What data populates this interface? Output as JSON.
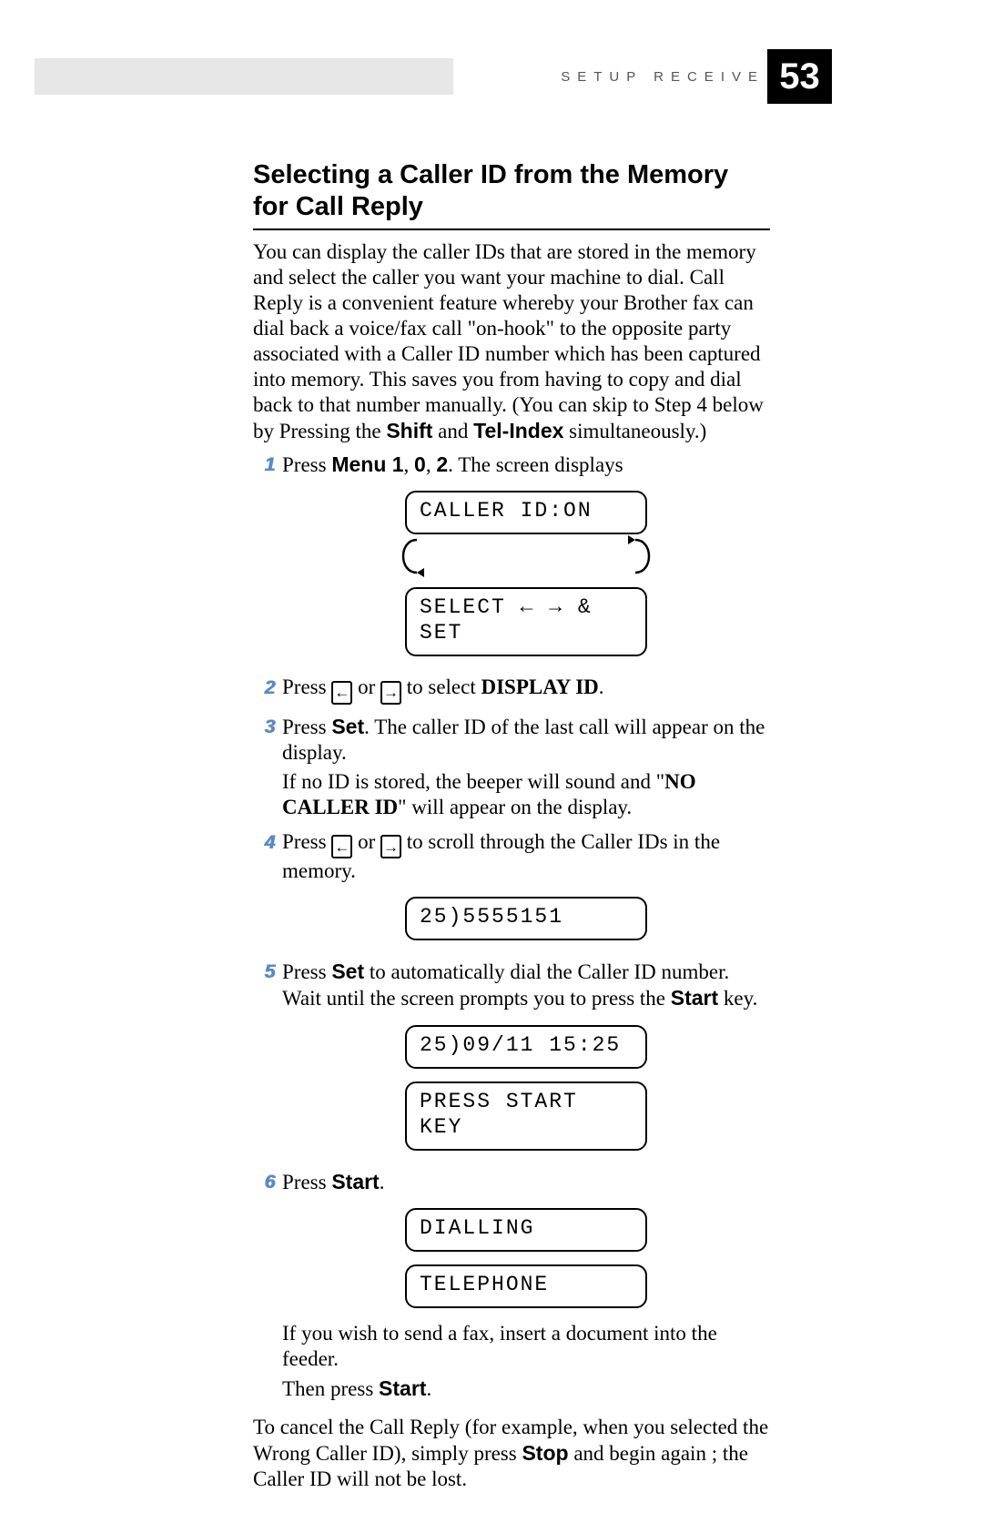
{
  "header": {
    "section": "SETUP RECEIVE",
    "page_number": "53"
  },
  "title": "Selecting a Caller ID from the Memory for Call Reply",
  "intro": {
    "pre": "You can display the caller IDs that are stored in the memory and select the caller you want your machine to dial. Call Reply is a convenient feature whereby your Brother fax can dial back a voice/fax call \"on-hook\" to the opposite party associated with a Caller ID number which has been captured into memory. This saves you from having to copy and dial back to that number manually. (You can skip to Step 4 below by Pressing the ",
    "shift": "Shift",
    "mid1": " and ",
    "telindex": "Tel-Index",
    "post": " simultaneously.)"
  },
  "steps": {
    "s1": {
      "num": "1",
      "pre": "Press ",
      "menu": "Menu 1",
      "mid1": ", ",
      "k0": "0",
      "mid2": ", ",
      "k2": "2",
      "tail": ". The screen displays",
      "lcd1": "CALLER ID:ON",
      "lcd2": "SELECT ← → & SET"
    },
    "s2": {
      "num": "2",
      "pre": "Press ",
      "or": " or ",
      "mid": " to select ",
      "disp": "DISPLAY ID",
      "dot": "."
    },
    "s3": {
      "num": "3",
      "pre": "Press ",
      "set": "Set",
      "mid1": ". The caller ID of the last call will appear on the display.",
      "p2a": "If no ID is stored, the beeper will sound and \"",
      "nocid": "NO CALLER ID",
      "p2b": "\" will appear on the display."
    },
    "s4": {
      "num": "4",
      "pre": "Press ",
      "or": " or ",
      "tail": " to scroll through the Caller IDs in the memory.",
      "lcd": "25)5555151"
    },
    "s5": {
      "num": "5",
      "pre": "Press ",
      "set": "Set",
      "mid": " to automatically dial the Caller ID number. Wait until the screen prompts you to press the ",
      "start": "Start",
      "tail": " key.",
      "lcd1": "25)09/11 15:25",
      "lcd2": "PRESS START KEY"
    },
    "s6": {
      "num": "6",
      "pre": "Press ",
      "start": "Start",
      "dot": ".",
      "lcd1": "DIALLING",
      "lcd2": "TELEPHONE",
      "p2": "If you wish to send a fax, insert a document into the feeder.",
      "p3a": "Then press ",
      "p3b": "Start",
      "p3c": "."
    }
  },
  "trailing": {
    "pre": "To cancel the Call Reply (for example, when you selected the Wrong Caller ID), simply press ",
    "stop": "Stop",
    "post": " and begin again ; the Caller ID will not be lost."
  },
  "icons": {
    "left": "←",
    "right": "→"
  }
}
